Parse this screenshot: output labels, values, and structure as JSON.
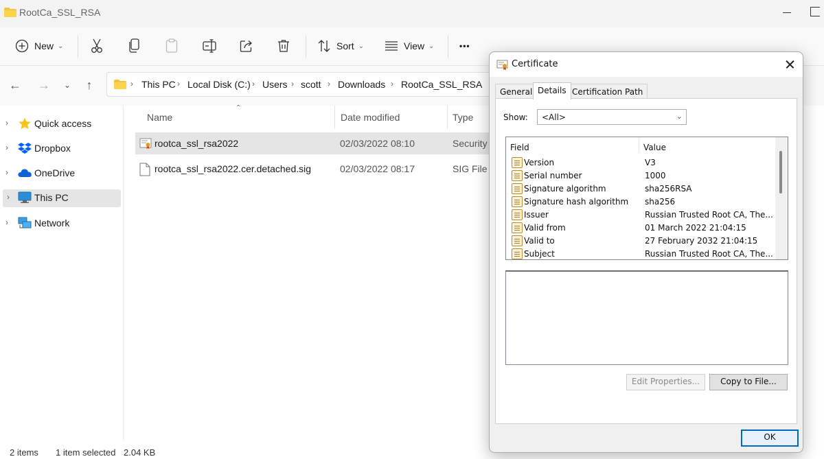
{
  "window": {
    "title": "RootCa_SSL_RSA"
  },
  "toolbar": {
    "new_label": "New",
    "sort_label": "Sort",
    "view_label": "View",
    "more_label": "•••"
  },
  "address": {
    "crumbs": [
      "This PC",
      "Local Disk (C:)",
      "Users",
      "scott",
      "Downloads",
      "RootCa_SSL_RSA"
    ]
  },
  "sidebar": {
    "items": [
      {
        "label": "Quick access",
        "icon": "star-icon"
      },
      {
        "label": "Dropbox",
        "icon": "dropbox-icon"
      },
      {
        "label": "OneDrive",
        "icon": "cloud-icon"
      },
      {
        "label": "This PC",
        "icon": "computer-icon",
        "selected": true
      },
      {
        "label": "Network",
        "icon": "network-icon"
      }
    ]
  },
  "filelist": {
    "columns": {
      "name": "Name",
      "date": "Date modified",
      "type": "Type"
    },
    "rows": [
      {
        "name": "rootca_ssl_rsa2022",
        "date": "02/03/2022 08:10",
        "type": "Security C",
        "icon": "certificate-file-icon",
        "selected": true
      },
      {
        "name": "rootca_ssl_rsa2022.cer.detached.sig",
        "date": "02/03/2022 08:17",
        "type": "SIG File",
        "icon": "file-icon",
        "selected": false
      }
    ]
  },
  "status": {
    "items": "2 items",
    "selection": "1 item selected",
    "size": "2.04 KB"
  },
  "dialog": {
    "title": "Certificate",
    "tabs": [
      "General",
      "Details",
      "Certification Path"
    ],
    "active_tab": "Details",
    "show_label": "Show:",
    "show_value": "<All>",
    "field_header": "Field",
    "value_header": "Value",
    "fields": [
      {
        "field": "Version",
        "value": "V3"
      },
      {
        "field": "Serial number",
        "value": "1000"
      },
      {
        "field": "Signature algorithm",
        "value": "sha256RSA"
      },
      {
        "field": "Signature hash algorithm",
        "value": "sha256"
      },
      {
        "field": "Issuer",
        "value": "Russian Trusted Root CA, The..."
      },
      {
        "field": "Valid from",
        "value": "01 March 2022 21:04:15"
      },
      {
        "field": "Valid to",
        "value": "27 February 2032 21:04:15"
      },
      {
        "field": "Subject",
        "value": "Russian Trusted Root CA, The..."
      }
    ],
    "edit_properties_label": "Edit Properties...",
    "copy_to_file_label": "Copy to File...",
    "ok_label": "OK"
  }
}
